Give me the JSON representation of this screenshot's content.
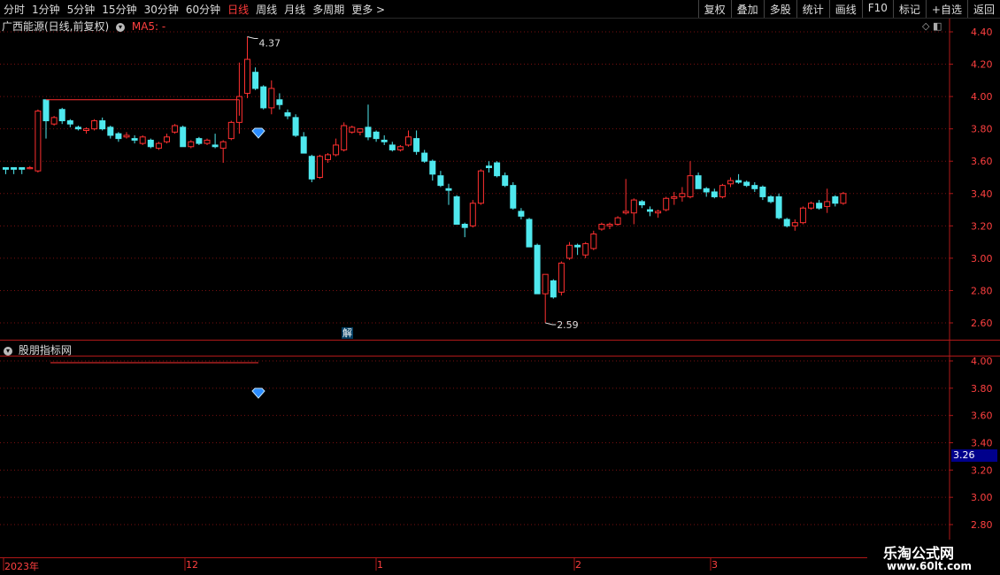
{
  "toolbar": {
    "periods": [
      "分时",
      "1分钟",
      "5分钟",
      "15分钟",
      "30分钟",
      "60分钟",
      "日线",
      "周线",
      "月线",
      "多周期",
      "更多 >"
    ],
    "active_period": "日线",
    "actions": [
      "复权",
      "叠加",
      "多股",
      "统计",
      "画线",
      "F10",
      "标记",
      "+自选",
      "返回"
    ]
  },
  "main_chart": {
    "title": "广西能源(日线,前复权)",
    "ma_label": "MA5: -",
    "y_ticks": [
      "4.40",
      "4.20",
      "4.00",
      "3.80",
      "3.60",
      "3.40",
      "3.20",
      "3.00",
      "2.80",
      "2.60"
    ],
    "high_annotation": "4.37",
    "low_annotation": "2.59",
    "badge": "解"
  },
  "sub_chart": {
    "title": "股朋指标网",
    "y_ticks": [
      "4.00",
      "3.80",
      "3.60",
      "3.40",
      "3.20",
      "3.00",
      "2.80"
    ],
    "current_value": "3.26"
  },
  "date_axis": [
    "2023年",
    "12",
    "1",
    "2",
    "3"
  ],
  "watermark": {
    "name": "乐淘公式网",
    "url": "www.60lt.com"
  },
  "colors": {
    "up": "#ff3030",
    "down": "#4fe8ee",
    "grid": "#7a1010",
    "axis": "#b01818"
  },
  "chart_data": {
    "type": "candlestick",
    "ylim": [
      2.55,
      4.45
    ],
    "candles": [
      [
        3.56,
        3.56,
        3.52,
        3.55
      ],
      [
        3.56,
        3.56,
        3.52,
        3.55
      ],
      [
        3.56,
        3.56,
        3.52,
        3.55
      ],
      [
        3.56,
        3.57,
        3.55,
        3.56
      ],
      [
        3.54,
        3.92,
        3.53,
        3.91
      ],
      [
        3.98,
        3.98,
        3.74,
        3.85
      ],
      [
        3.83,
        3.88,
        3.82,
        3.87
      ],
      [
        3.92,
        3.93,
        3.83,
        3.85
      ],
      [
        3.85,
        3.86,
        3.81,
        3.83
      ],
      [
        3.81,
        3.82,
        3.79,
        3.8
      ],
      [
        3.79,
        3.81,
        3.77,
        3.8
      ],
      [
        3.8,
        3.86,
        3.79,
        3.85
      ],
      [
        3.85,
        3.87,
        3.79,
        3.8
      ],
      [
        3.81,
        3.82,
        3.74,
        3.76
      ],
      [
        3.77,
        3.78,
        3.72,
        3.74
      ],
      [
        3.75,
        3.78,
        3.74,
        3.76
      ],
      [
        3.74,
        3.76,
        3.71,
        3.73
      ],
      [
        3.71,
        3.76,
        3.7,
        3.75
      ],
      [
        3.73,
        3.74,
        3.68,
        3.69
      ],
      [
        3.68,
        3.72,
        3.67,
        3.71
      ],
      [
        3.72,
        3.77,
        3.71,
        3.75
      ],
      [
        3.78,
        3.83,
        3.77,
        3.82
      ],
      [
        3.81,
        3.82,
        3.69,
        3.69
      ],
      [
        3.69,
        3.73,
        3.68,
        3.72
      ],
      [
        3.74,
        3.75,
        3.7,
        3.71
      ],
      [
        3.71,
        3.74,
        3.7,
        3.73
      ],
      [
        3.7,
        3.77,
        3.68,
        3.69
      ],
      [
        3.68,
        3.73,
        3.59,
        3.72
      ],
      [
        3.74,
        3.85,
        3.73,
        3.84
      ],
      [
        3.84,
        4.21,
        3.77,
        4.0
      ],
      [
        4.02,
        4.37,
        3.99,
        4.23
      ],
      [
        4.15,
        4.18,
        4.04,
        4.05
      ],
      [
        4.06,
        4.07,
        3.92,
        3.93
      ],
      [
        3.93,
        4.1,
        3.89,
        4.05
      ],
      [
        3.98,
        4.02,
        3.92,
        3.95
      ],
      [
        3.9,
        3.92,
        3.86,
        3.88
      ],
      [
        3.87,
        3.89,
        3.75,
        3.76
      ],
      [
        3.75,
        3.78,
        3.65,
        3.65
      ],
      [
        3.63,
        3.64,
        3.47,
        3.49
      ],
      [
        3.5,
        3.64,
        3.49,
        3.63
      ],
      [
        3.61,
        3.65,
        3.59,
        3.64
      ],
      [
        3.64,
        3.74,
        3.63,
        3.7
      ],
      [
        3.67,
        3.84,
        3.66,
        3.82
      ],
      [
        3.78,
        3.82,
        3.77,
        3.81
      ],
      [
        3.78,
        3.8,
        3.76,
        3.8
      ],
      [
        3.81,
        3.95,
        3.73,
        3.75
      ],
      [
        3.78,
        3.79,
        3.72,
        3.74
      ],
      [
        3.73,
        3.76,
        3.7,
        3.72
      ],
      [
        3.7,
        3.72,
        3.66,
        3.67
      ],
      [
        3.67,
        3.7,
        3.66,
        3.69
      ],
      [
        3.7,
        3.79,
        3.69,
        3.75
      ],
      [
        3.74,
        3.79,
        3.64,
        3.66
      ],
      [
        3.65,
        3.67,
        3.59,
        3.6
      ],
      [
        3.6,
        3.61,
        3.48,
        3.52
      ],
      [
        3.51,
        3.54,
        3.44,
        3.45
      ],
      [
        3.43,
        3.46,
        3.33,
        3.42
      ],
      [
        3.38,
        3.39,
        3.21,
        3.21
      ],
      [
        3.21,
        3.22,
        3.13,
        3.19
      ],
      [
        3.2,
        3.36,
        3.19,
        3.34
      ],
      [
        3.34,
        3.55,
        3.33,
        3.54
      ],
      [
        3.57,
        3.6,
        3.53,
        3.56
      ],
      [
        3.59,
        3.6,
        3.5,
        3.51
      ],
      [
        3.51,
        3.53,
        3.44,
        3.45
      ],
      [
        3.45,
        3.47,
        3.3,
        3.31
      ],
      [
        3.29,
        3.31,
        3.24,
        3.26
      ],
      [
        3.24,
        3.25,
        3.07,
        3.07
      ],
      [
        3.08,
        3.09,
        2.78,
        2.78
      ],
      [
        2.78,
        2.9,
        2.6,
        2.9
      ],
      [
        2.86,
        2.87,
        2.75,
        2.76
      ],
      [
        2.79,
        2.98,
        2.77,
        2.97
      ],
      [
        3.0,
        3.1,
        2.99,
        3.08
      ],
      [
        3.08,
        3.09,
        3.02,
        3.07
      ],
      [
        3.02,
        3.1,
        3.0,
        3.09
      ],
      [
        3.06,
        3.17,
        3.05,
        3.15
      ],
      [
        3.18,
        3.22,
        3.17,
        3.21
      ],
      [
        3.2,
        3.22,
        3.18,
        3.21
      ],
      [
        3.21,
        3.26,
        3.2,
        3.25
      ],
      [
        3.28,
        3.49,
        3.27,
        3.29
      ],
      [
        3.28,
        3.37,
        3.21,
        3.36
      ],
      [
        3.35,
        3.36,
        3.31,
        3.33
      ],
      [
        3.3,
        3.32,
        3.26,
        3.29
      ],
      [
        3.28,
        3.3,
        3.25,
        3.29
      ],
      [
        3.3,
        3.38,
        3.29,
        3.37
      ],
      [
        3.37,
        3.41,
        3.33,
        3.38
      ],
      [
        3.38,
        3.44,
        3.35,
        3.4
      ],
      [
        3.38,
        3.6,
        3.37,
        3.51
      ],
      [
        3.51,
        3.53,
        3.43,
        3.43
      ],
      [
        3.43,
        3.44,
        3.38,
        3.41
      ],
      [
        3.41,
        3.43,
        3.37,
        3.38
      ],
      [
        3.38,
        3.46,
        3.37,
        3.45
      ],
      [
        3.46,
        3.5,
        3.44,
        3.48
      ],
      [
        3.48,
        3.52,
        3.46,
        3.47
      ],
      [
        3.47,
        3.48,
        3.44,
        3.45
      ],
      [
        3.45,
        3.47,
        3.41,
        3.43
      ],
      [
        3.44,
        3.45,
        3.36,
        3.38
      ],
      [
        3.38,
        3.39,
        3.34,
        3.35
      ],
      [
        3.38,
        3.4,
        3.24,
        3.25
      ],
      [
        3.24,
        3.25,
        3.19,
        3.2
      ],
      [
        3.2,
        3.24,
        3.17,
        3.22
      ],
      [
        3.22,
        3.32,
        3.21,
        3.31
      ],
      [
        3.31,
        3.35,
        3.3,
        3.34
      ],
      [
        3.34,
        3.36,
        3.3,
        3.31
      ],
      [
        3.32,
        3.43,
        3.28,
        3.35
      ],
      [
        3.38,
        3.39,
        3.32,
        3.34
      ],
      [
        3.34,
        3.41,
        3.33,
        3.4
      ]
    ]
  }
}
